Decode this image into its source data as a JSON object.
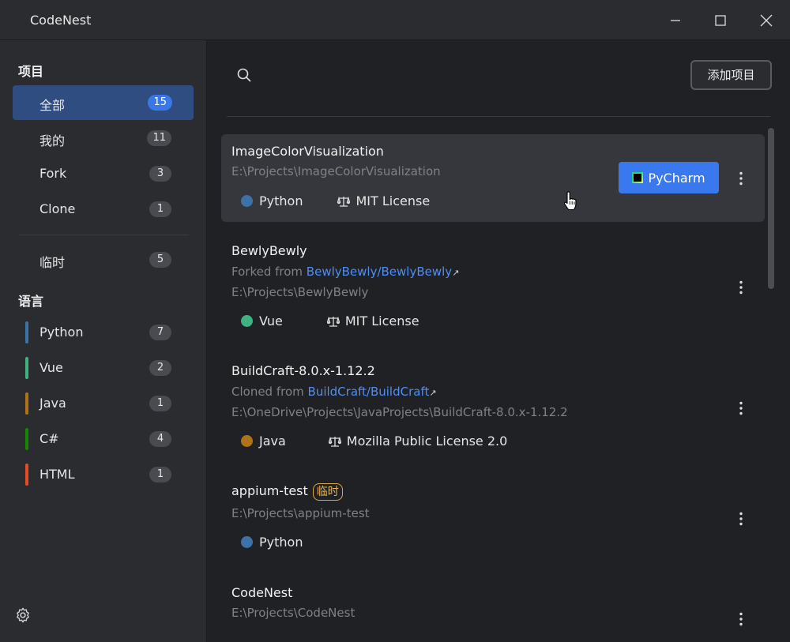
{
  "app": {
    "title": "CodeNest"
  },
  "sidebar": {
    "projects_title": "项目",
    "project_filters": [
      {
        "label": "全部",
        "count": "15",
        "active": true
      },
      {
        "label": "我的",
        "count": "11"
      },
      {
        "label": "Fork",
        "count": "3"
      },
      {
        "label": "Clone",
        "count": "1"
      }
    ],
    "temp": {
      "label": "临时",
      "count": "5"
    },
    "languages_title": "语言",
    "languages": [
      {
        "label": "Python",
        "count": "7",
        "color": "#3b72a8"
      },
      {
        "label": "Vue",
        "count": "2",
        "color": "#3fb27f"
      },
      {
        "label": "Java",
        "count": "1",
        "color": "#b07219"
      },
      {
        "label": "C#",
        "count": "4",
        "color": "#178600"
      },
      {
        "label": "HTML",
        "count": "1",
        "color": "#e34c26"
      }
    ]
  },
  "toolbar": {
    "search_placeholder": "",
    "add_button": "添加项目"
  },
  "projects": [
    {
      "name": "ImageColorVisualization",
      "path": "E:\\Projects\\ImageColorVisualization",
      "language": "Python",
      "language_color": "#3b72a8",
      "license": "MIT License",
      "ide_button": "PyCharm"
    },
    {
      "name": "BewlyBewly",
      "source_prefix": "Forked from ",
      "source_link": "BewlyBewly/BewlyBewly",
      "path": "E:\\Projects\\BewlyBewly",
      "language": "Vue",
      "language_color": "#3fb27f",
      "license": "MIT License"
    },
    {
      "name": "BuildCraft-8.0.x-1.12.2",
      "source_prefix": "Cloned from ",
      "source_link": "BuildCraft/BuildCraft",
      "path": "E:\\OneDrive\\Projects\\JavaProjects\\BuildCraft-8.0.x-1.12.2",
      "language": "Java",
      "language_color": "#b07219",
      "license": "Mozilla Public License 2.0"
    },
    {
      "name": "appium-test",
      "tag": "临时",
      "path": "E:\\Projects\\appium-test",
      "language": "Python",
      "language_color": "#3b72a8"
    },
    {
      "name": "CodeNest",
      "path": "E:\\Projects\\CodeNest"
    }
  ]
}
